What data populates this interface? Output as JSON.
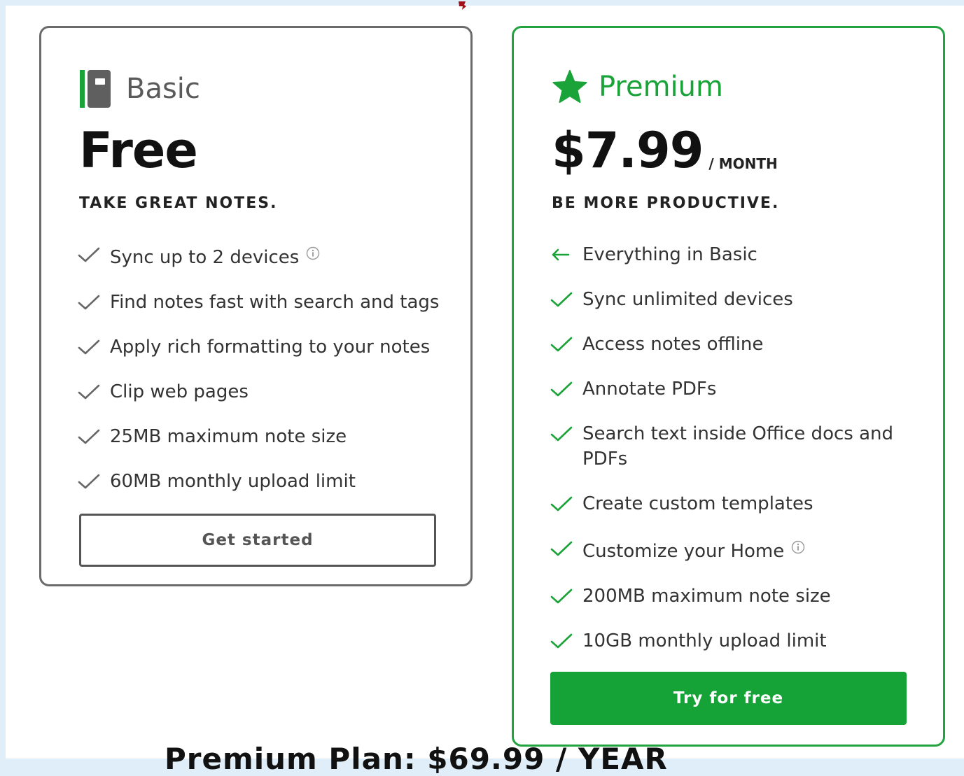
{
  "colors": {
    "page_background": "#dfeef8",
    "basic_border": "#6b6b6b",
    "premium_accent": "#1aa339",
    "button_green": "#15a236",
    "check_gray": "#666666",
    "check_green": "#1aa339"
  },
  "basic": {
    "icon": "notebook-icon",
    "name": "Basic",
    "price": "Free",
    "tagline": "TAKE GREAT NOTES.",
    "features": [
      {
        "text": "Sync up to 2 devices",
        "icon": "check-icon",
        "info": true
      },
      {
        "text": "Find notes fast with search and tags",
        "icon": "check-icon"
      },
      {
        "text": "Apply rich formatting to your notes",
        "icon": "check-icon"
      },
      {
        "text": "Clip web pages",
        "icon": "check-icon"
      },
      {
        "text": "25MB maximum note size",
        "icon": "check-icon"
      },
      {
        "text": "60MB monthly upload limit",
        "icon": "check-icon"
      }
    ],
    "cta": "Get started"
  },
  "premium": {
    "icon": "star-icon",
    "name": "Premium",
    "price": "$7.99",
    "per": "/ MONTH",
    "tagline": "BE MORE PRODUCTIVE.",
    "features": [
      {
        "text": "Everything in Basic",
        "icon": "arrow-left-icon"
      },
      {
        "text": "Sync unlimited devices",
        "icon": "check-icon"
      },
      {
        "text": "Access notes offline",
        "icon": "check-icon"
      },
      {
        "text": "Annotate PDFs",
        "icon": "check-icon"
      },
      {
        "text": "Search text inside Office docs and PDFs",
        "icon": "check-icon"
      },
      {
        "text": "Create custom templates",
        "icon": "check-icon"
      },
      {
        "text": "Customize your Home",
        "icon": "check-icon",
        "info": true
      },
      {
        "text": "200MB maximum note size",
        "icon": "check-icon"
      },
      {
        "text": "10GB monthly upload limit",
        "icon": "check-icon"
      }
    ],
    "cta": "Try for free"
  },
  "caption": "Premium Plan: $69.99 / YEAR"
}
